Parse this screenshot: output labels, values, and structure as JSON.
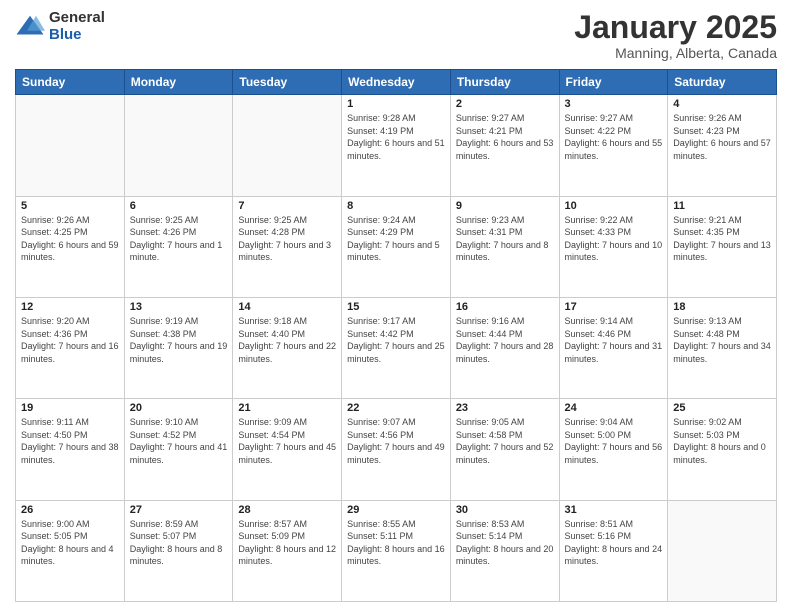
{
  "header": {
    "logo_general": "General",
    "logo_blue": "Blue",
    "title": "January 2025",
    "location": "Manning, Alberta, Canada"
  },
  "days_of_week": [
    "Sunday",
    "Monday",
    "Tuesday",
    "Wednesday",
    "Thursday",
    "Friday",
    "Saturday"
  ],
  "weeks": [
    [
      {
        "day": "",
        "info": ""
      },
      {
        "day": "",
        "info": ""
      },
      {
        "day": "",
        "info": ""
      },
      {
        "day": "1",
        "info": "Sunrise: 9:28 AM\nSunset: 4:19 PM\nDaylight: 6 hours and 51 minutes."
      },
      {
        "day": "2",
        "info": "Sunrise: 9:27 AM\nSunset: 4:21 PM\nDaylight: 6 hours and 53 minutes."
      },
      {
        "day": "3",
        "info": "Sunrise: 9:27 AM\nSunset: 4:22 PM\nDaylight: 6 hours and 55 minutes."
      },
      {
        "day": "4",
        "info": "Sunrise: 9:26 AM\nSunset: 4:23 PM\nDaylight: 6 hours and 57 minutes."
      }
    ],
    [
      {
        "day": "5",
        "info": "Sunrise: 9:26 AM\nSunset: 4:25 PM\nDaylight: 6 hours and 59 minutes."
      },
      {
        "day": "6",
        "info": "Sunrise: 9:25 AM\nSunset: 4:26 PM\nDaylight: 7 hours and 1 minute."
      },
      {
        "day": "7",
        "info": "Sunrise: 9:25 AM\nSunset: 4:28 PM\nDaylight: 7 hours and 3 minutes."
      },
      {
        "day": "8",
        "info": "Sunrise: 9:24 AM\nSunset: 4:29 PM\nDaylight: 7 hours and 5 minutes."
      },
      {
        "day": "9",
        "info": "Sunrise: 9:23 AM\nSunset: 4:31 PM\nDaylight: 7 hours and 8 minutes."
      },
      {
        "day": "10",
        "info": "Sunrise: 9:22 AM\nSunset: 4:33 PM\nDaylight: 7 hours and 10 minutes."
      },
      {
        "day": "11",
        "info": "Sunrise: 9:21 AM\nSunset: 4:35 PM\nDaylight: 7 hours and 13 minutes."
      }
    ],
    [
      {
        "day": "12",
        "info": "Sunrise: 9:20 AM\nSunset: 4:36 PM\nDaylight: 7 hours and 16 minutes."
      },
      {
        "day": "13",
        "info": "Sunrise: 9:19 AM\nSunset: 4:38 PM\nDaylight: 7 hours and 19 minutes."
      },
      {
        "day": "14",
        "info": "Sunrise: 9:18 AM\nSunset: 4:40 PM\nDaylight: 7 hours and 22 minutes."
      },
      {
        "day": "15",
        "info": "Sunrise: 9:17 AM\nSunset: 4:42 PM\nDaylight: 7 hours and 25 minutes."
      },
      {
        "day": "16",
        "info": "Sunrise: 9:16 AM\nSunset: 4:44 PM\nDaylight: 7 hours and 28 minutes."
      },
      {
        "day": "17",
        "info": "Sunrise: 9:14 AM\nSunset: 4:46 PM\nDaylight: 7 hours and 31 minutes."
      },
      {
        "day": "18",
        "info": "Sunrise: 9:13 AM\nSunset: 4:48 PM\nDaylight: 7 hours and 34 minutes."
      }
    ],
    [
      {
        "day": "19",
        "info": "Sunrise: 9:11 AM\nSunset: 4:50 PM\nDaylight: 7 hours and 38 minutes."
      },
      {
        "day": "20",
        "info": "Sunrise: 9:10 AM\nSunset: 4:52 PM\nDaylight: 7 hours and 41 minutes."
      },
      {
        "day": "21",
        "info": "Sunrise: 9:09 AM\nSunset: 4:54 PM\nDaylight: 7 hours and 45 minutes."
      },
      {
        "day": "22",
        "info": "Sunrise: 9:07 AM\nSunset: 4:56 PM\nDaylight: 7 hours and 49 minutes."
      },
      {
        "day": "23",
        "info": "Sunrise: 9:05 AM\nSunset: 4:58 PM\nDaylight: 7 hours and 52 minutes."
      },
      {
        "day": "24",
        "info": "Sunrise: 9:04 AM\nSunset: 5:00 PM\nDaylight: 7 hours and 56 minutes."
      },
      {
        "day": "25",
        "info": "Sunrise: 9:02 AM\nSunset: 5:03 PM\nDaylight: 8 hours and 0 minutes."
      }
    ],
    [
      {
        "day": "26",
        "info": "Sunrise: 9:00 AM\nSunset: 5:05 PM\nDaylight: 8 hours and 4 minutes."
      },
      {
        "day": "27",
        "info": "Sunrise: 8:59 AM\nSunset: 5:07 PM\nDaylight: 8 hours and 8 minutes."
      },
      {
        "day": "28",
        "info": "Sunrise: 8:57 AM\nSunset: 5:09 PM\nDaylight: 8 hours and 12 minutes."
      },
      {
        "day": "29",
        "info": "Sunrise: 8:55 AM\nSunset: 5:11 PM\nDaylight: 8 hours and 16 minutes."
      },
      {
        "day": "30",
        "info": "Sunrise: 8:53 AM\nSunset: 5:14 PM\nDaylight: 8 hours and 20 minutes."
      },
      {
        "day": "31",
        "info": "Sunrise: 8:51 AM\nSunset: 5:16 PM\nDaylight: 8 hours and 24 minutes."
      },
      {
        "day": "",
        "info": ""
      }
    ]
  ]
}
